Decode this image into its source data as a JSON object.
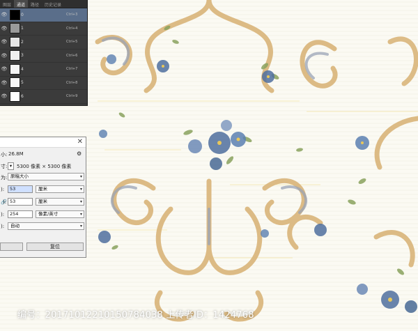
{
  "channels_panel": {
    "tabs": [
      "图层",
      "通道",
      "路径",
      "历史记录"
    ],
    "active_tab_index": 1,
    "rows": [
      {
        "name": "0",
        "shortcut": "Ctrl+3",
        "thumb": "#000000",
        "selected": true
      },
      {
        "name": "1",
        "shortcut": "Ctrl+4",
        "thumb": "#9a9a9a",
        "selected": false
      },
      {
        "name": "2",
        "shortcut": "Ctrl+5",
        "thumb": "#e6e6e6",
        "selected": false
      },
      {
        "name": "3",
        "shortcut": "Ctrl+6",
        "thumb": "#f0f0f0",
        "selected": false
      },
      {
        "name": "4",
        "shortcut": "Ctrl+7",
        "thumb": "#f4f4f4",
        "selected": false
      },
      {
        "name": "5",
        "shortcut": "Ctrl+8",
        "thumb": "#f6f6f6",
        "selected": false
      },
      {
        "name": "6",
        "shortcut": "Ctrl+9",
        "thumb": "#ffffff",
        "selected": false
      }
    ]
  },
  "image_size_dialog": {
    "size_label": "小:",
    "size_value": "26.8M",
    "dims_label": "寸:",
    "dims_value": "5300 像素 × 5300 像素",
    "fit_label": "为:",
    "fit_value": "原稿大小",
    "width_label": "):",
    "width_value": "53",
    "width_unit": "厘米",
    "height_label": "):",
    "height_value": "53",
    "height_unit": "厘米",
    "resolution_label": "):",
    "resolution_value": "254",
    "resolution_unit": "像素/英寸",
    "resample_label": "):",
    "resample_value": "自动",
    "ok_label": "",
    "reset_label": "复位"
  },
  "watermark": {
    "text": "编号：20171012210150784038 上传者ID：1424768"
  },
  "colors": {
    "panel_bg": "#3b3b3b",
    "selected_row": "#5a6e8a",
    "canvas_bg": "#fbfaf3",
    "scroll_gold": "#d9b57a",
    "flower_blue": "#4f6f9e",
    "leaf_green": "#8aa35e"
  }
}
